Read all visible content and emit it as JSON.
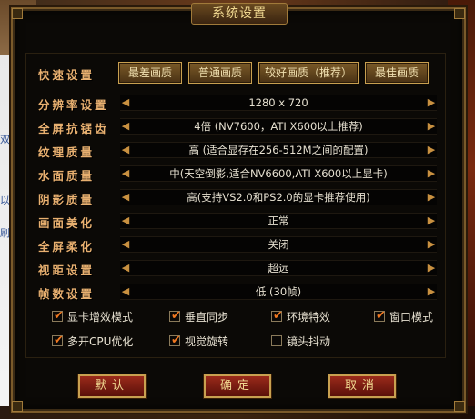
{
  "backdrop": {
    "fragments": [
      "双",
      "以",
      "刷"
    ]
  },
  "dialog": {
    "title": "系统设置"
  },
  "quick": {
    "label": "快速设置",
    "buttons": [
      "最差画质",
      "普通画质",
      "较好画质（推荐）",
      "最佳画质"
    ]
  },
  "settings": [
    {
      "label": "分辨率设置",
      "value": "1280 x 720"
    },
    {
      "label": "全屏抗锯齿",
      "value": "4倍 (NV7600，ATI X600以上推荐)"
    },
    {
      "label": "纹理质量",
      "value": "高 (适合显存在256-512M之间的配置)"
    },
    {
      "label": "水面质量",
      "value": "中(天空倒影,适合NV6600,ATI X600以上显卡)"
    },
    {
      "label": "阴影质量",
      "value": "高(支持VS2.0和PS2.0的显卡推荐使用)"
    },
    {
      "label": "画面美化",
      "value": "正常"
    },
    {
      "label": "全屏柔化",
      "value": "关闭"
    },
    {
      "label": "视距设置",
      "value": "超远"
    },
    {
      "label": "帧数设置",
      "value": "低 (30帧)"
    }
  ],
  "options": [
    {
      "label": "显卡增效模式",
      "checked": true
    },
    {
      "label": "垂直同步",
      "checked": true
    },
    {
      "label": "环境特效",
      "checked": true
    },
    {
      "label": "窗口模式",
      "checked": true
    },
    {
      "label": "多开CPU优化",
      "checked": true
    },
    {
      "label": "视觉旋转",
      "checked": true
    },
    {
      "label": "镜头抖动",
      "checked": false
    }
  ],
  "actions": {
    "default": "默认",
    "confirm": "确定",
    "cancel": "取消"
  },
  "glyphs": {
    "left_arrow": "◀",
    "right_arrow": "▶",
    "check": "✔"
  },
  "colors": {
    "label": "#e8b070",
    "value": "#e6e0d0",
    "frame": "#7a5a2a",
    "check": "#f07820"
  }
}
